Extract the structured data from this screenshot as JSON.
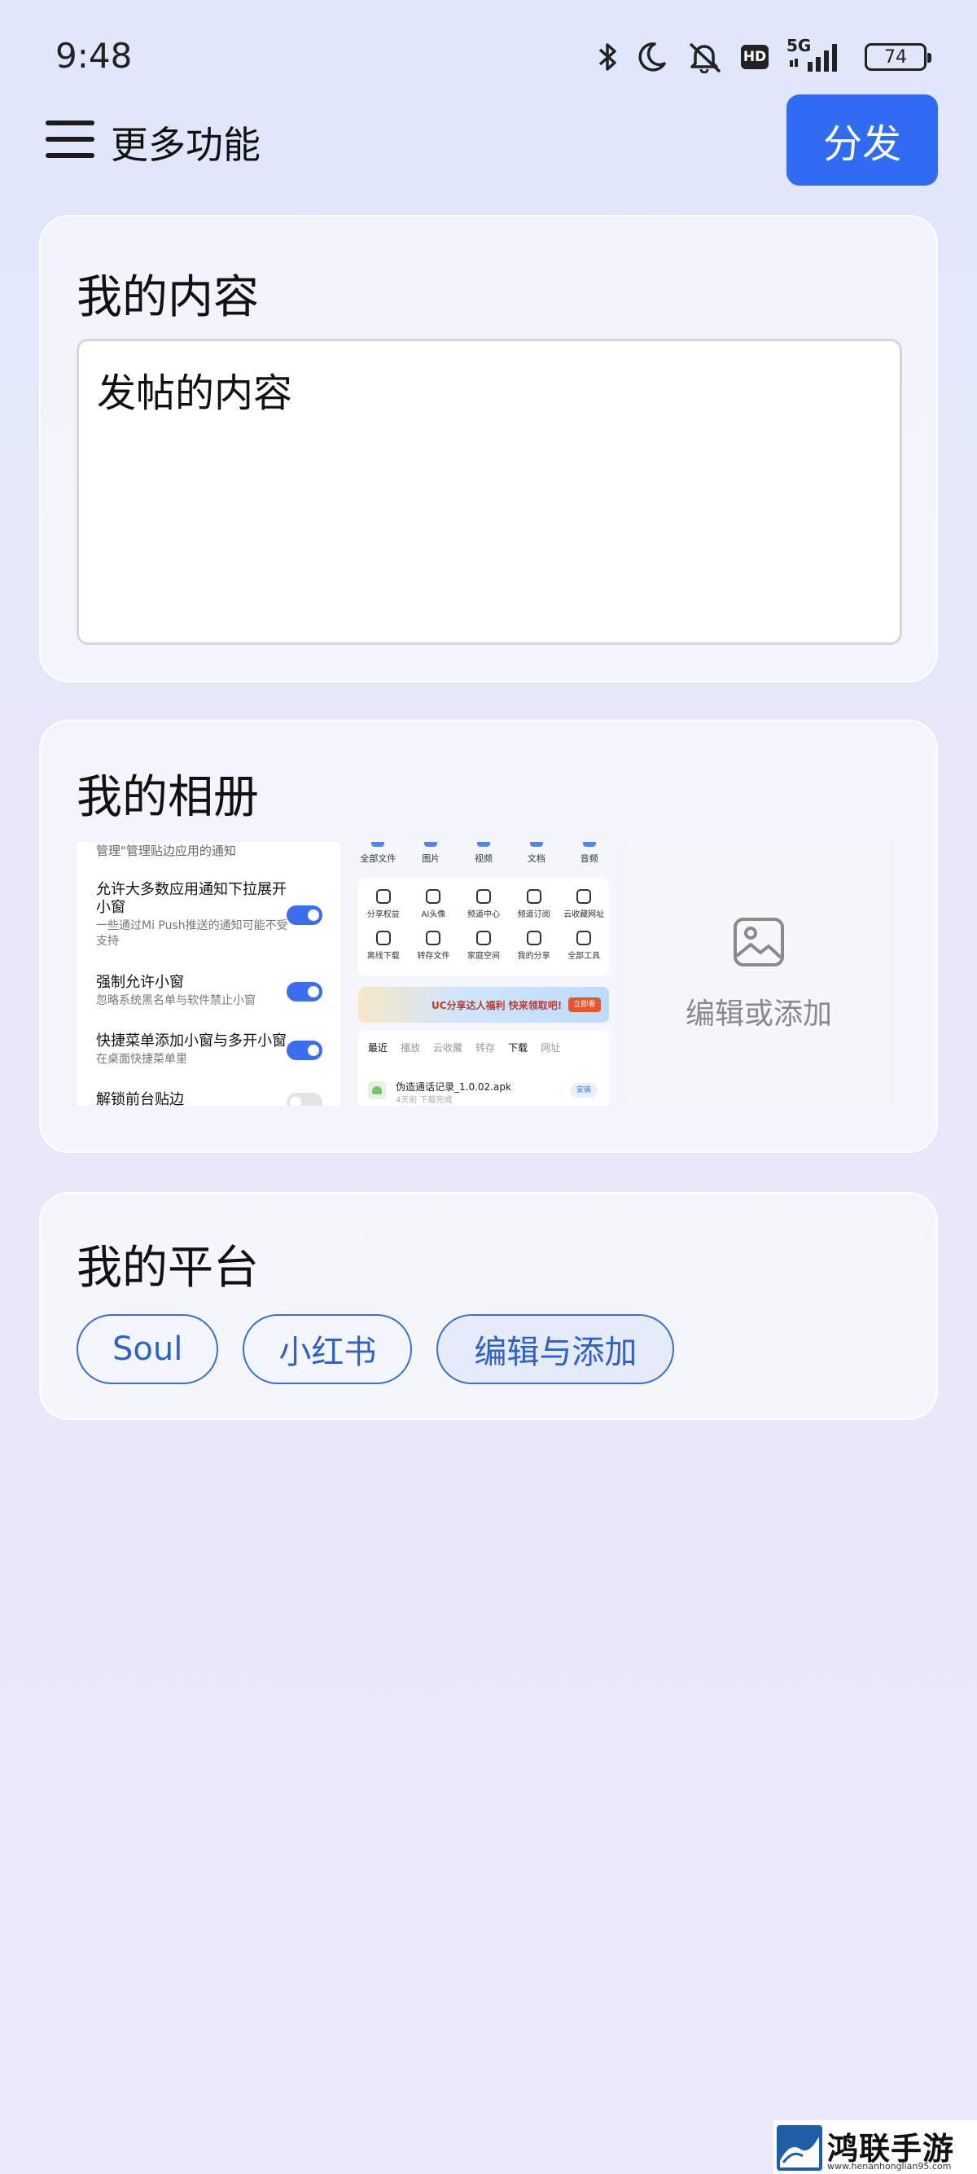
{
  "status_bar": {
    "time": "9:48",
    "network_label": "5G",
    "hd_label": "HD",
    "battery": "74",
    "icons": [
      "bluetooth-icon",
      "moon-icon",
      "mute-icon",
      "hd-icon",
      "signal-icon",
      "battery-icon"
    ]
  },
  "header": {
    "title": "更多功能",
    "send_label": "分发"
  },
  "content_section": {
    "title": "我的内容",
    "text_value": "发帖的内容"
  },
  "album_section": {
    "title": "我的相册",
    "thumb1": {
      "top_text": "管理\"管理贴边应用的通知",
      "rows": [
        {
          "title": "允许大多数应用通知下拉展开小窗",
          "desc": "一些通过Mi Push推送的通知可能不受支持"
        },
        {
          "title": "强制允许小窗",
          "desc": "忽略系统黑名单与软件禁止小窗"
        },
        {
          "title": "快捷菜单添加小窗与多开小窗",
          "desc": "在桌面快捷菜单里"
        },
        {
          "title": "解锁前台贴边",
          "desc": ""
        }
      ]
    },
    "thumb2": {
      "top": [
        "全部文件",
        "图片",
        "视频",
        "文档",
        "音频"
      ],
      "grid": [
        "分享权益",
        "AI头像",
        "频道中心",
        "频道订阅",
        "云收藏网址",
        "离线下载",
        "转存文件",
        "家庭空间",
        "我的分享",
        "全部工具"
      ],
      "banner_text": "UC分享达人福利 快来领取吧!",
      "banner_btn": "立即看",
      "tabs": [
        "最近",
        "播放",
        "云收藏",
        "转存",
        "下载",
        "网址"
      ],
      "file_name": "伪造通话记录_1.0.02.apk",
      "file_meta": "4天前 下载完成",
      "file_btn": "安装"
    },
    "add_label": "编辑或添加"
  },
  "platform_section": {
    "title": "我的平台",
    "chips": [
      "Soul",
      "小红书"
    ],
    "edit_label": "编辑与添加"
  },
  "watermark": {
    "title": "鸿联手游网",
    "url": "www.henanhonglian95.com"
  },
  "colors": {
    "accent": "#2f6cf3",
    "chip_border": "#3b6fc9"
  }
}
